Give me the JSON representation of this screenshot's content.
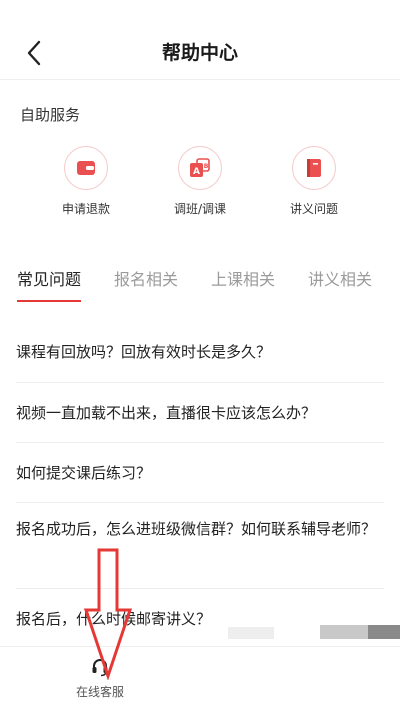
{
  "header": {
    "title": "帮助中心",
    "back_icon": "chevron-left-icon"
  },
  "self_service": {
    "title": "自助服务",
    "items": [
      {
        "label": "申请退款",
        "icon": "wallet-icon"
      },
      {
        "label": "调班/调课",
        "icon": "switch-class-icon"
      },
      {
        "label": "讲义问题",
        "icon": "book-icon"
      }
    ]
  },
  "tabs": [
    {
      "label": "常见问题",
      "active": true
    },
    {
      "label": "报名相关",
      "active": false
    },
    {
      "label": "上课相关",
      "active": false
    },
    {
      "label": "讲义相关",
      "active": false
    }
  ],
  "faq": [
    "课程有回放吗？回放有效时长是多久？",
    "视频一直加载不出来，直播很卡应该怎么办？",
    "如何提交课后练习？",
    "报名成功后，怎么进班级微信群？如何联系辅导老师？",
    "报名后，什么时候邮寄讲义？"
  ],
  "bottom_bar": {
    "label": "在线客服",
    "icon": "headset-icon"
  },
  "colors": {
    "accent": "#e53935",
    "icon_red": "#e9504f",
    "icon_border": "#f4c9c9"
  }
}
